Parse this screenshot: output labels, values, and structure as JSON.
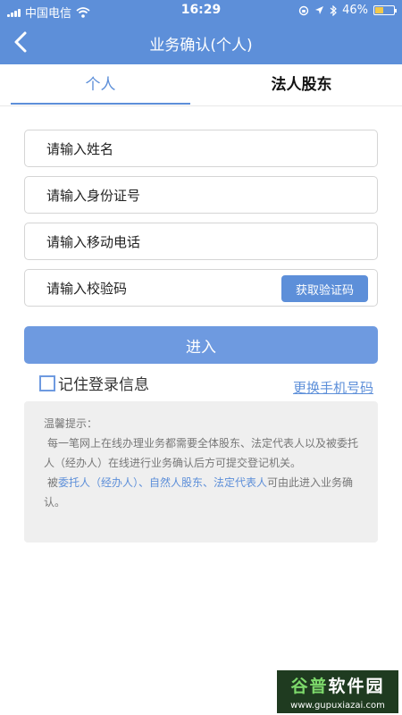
{
  "status_bar": {
    "carrier": "中国电信",
    "time": "16:29",
    "battery": "46%",
    "battery_level": 0.46
  },
  "header": {
    "title": "业务确认(个人)",
    "back_icon": "chevron-left-icon"
  },
  "tabs": [
    {
      "label": "个人",
      "active": true
    },
    {
      "label": "法人股东",
      "active": false
    }
  ],
  "form": {
    "name_placeholder": "请输入姓名",
    "id_placeholder": "请输入身份证号",
    "phone_placeholder": "请输入移动电话",
    "code_placeholder": "请输入校验码",
    "get_code_label": "获取验证码",
    "enter_label": "进入",
    "remember_label": "记住登录信息",
    "change_phone_label": "更换手机号码"
  },
  "notice": {
    "heading": "温馨提示：",
    "para1": "每一笔网上在线办理业务都需要全体股东、法定代表人以及被委托人（经办人）在线进行业务确认后方可提交登记机关。",
    "para2_prefix": "被",
    "para2_highlight": "委托人（经办人）、自然人股东、法定代表人",
    "para2_suffix": "可由此进入业务确认。"
  },
  "watermark": {
    "brand_a": "谷普",
    "brand_b": "软件园",
    "url": "www.gupuxiazai.com"
  },
  "colors": {
    "primary": "#5d8fd9",
    "button": "#6e9ae0",
    "notice_bg": "#efefef"
  }
}
